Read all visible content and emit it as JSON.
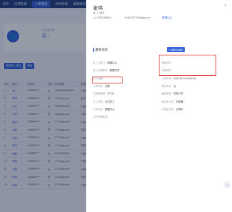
{
  "topnav": {
    "items": [
      "首页",
      "招聘管理",
      "人事管理",
      "绩效管理",
      "薪酬福利管理"
    ],
    "active_index": 2
  },
  "background": {
    "stats": [
      {
        "label": "待入职人数",
        "value": "0",
        "unit": "人"
      },
      {
        "label": "在职人数",
        "value": "20",
        "unit": "人"
      }
    ],
    "buttons": [
      "批量导入/导出",
      "筛选"
    ],
    "table_header": [
      "序号",
      "姓名",
      "手机号",
      "性别",
      "电子邮箱",
      "所属部门"
    ],
    "rows": [
      [
        "1",
        "张三",
        "1305690****",
        "女",
        "zhangsan@qq.com",
        "产品部"
      ],
      [
        "2",
        "李明",
        "1355690****",
        "男",
        "1234@qq.com",
        "设计部"
      ],
      [
        "3",
        "王芳",
        "1505690****",
        "女",
        "1234@qq.com",
        "产品部"
      ],
      [
        "4",
        "刘洋",
        "1505690****",
        "男",
        "1234@qq.com",
        "开发部"
      ],
      [
        "5",
        "陈静",
        "1585690****",
        "女",
        "2371@qq.com",
        "产品部"
      ],
      [
        "6",
        "赵磊",
        "1595690****",
        "男",
        "2371@qq.com",
        "开发部"
      ],
      [
        "7",
        "孙丽",
        "1325690****",
        "女",
        "2371@qq.com",
        "产品部"
      ],
      [
        "8",
        "周杰",
        "1335690****",
        "男",
        "2371@qq.com",
        "开发部"
      ],
      [
        "9",
        "吴敏",
        "1525690****",
        "女",
        "2371@qq.com",
        "产品部"
      ],
      [
        "10",
        "郑强",
        "1785690****",
        "男",
        "2371@qq.com",
        "产品部"
      ],
      [
        "11",
        "冯雪",
        "1795690****",
        "女",
        "2371@qq.com",
        "产品部"
      ],
      [
        "12",
        "林涛",
        "1805690****",
        "男",
        "2371@qq.com",
        "开发部"
      ],
      [
        "13",
        "何静",
        "1815690****",
        "女",
        "2371@qq.com",
        "产品部"
      ]
    ]
  },
  "drawer": {
    "name": "张伟",
    "meta": "男 丨 26岁",
    "phone": "13551508611",
    "email": "651307752@qq.com",
    "department_tag": "数据中心",
    "section_title": "基本信息",
    "edit_button": "编辑基本信息",
    "fields_left": [
      {
        "k": "员工归属门：",
        "v": "数据中心"
      },
      {
        "k": "员工归属职务：",
        "v": "数据专员"
      },
      {
        "k": "员工职级：",
        "v": ""
      },
      {
        "k": "入职状态：",
        "v": "试用"
      },
      {
        "k": "试用期期限：",
        "v": "3个月"
      },
      {
        "k": "员工类型：",
        "v": "正式员工"
      },
      {
        "k": "工作地点：",
        "v": "数据中心"
      },
      {
        "k": "合同签署类型：",
        "v": ""
      }
    ],
    "fields_right": [
      {
        "k": "直属领导：",
        "v": ""
      },
      {
        "k": "间接领导：",
        "v": ""
      },
      {
        "k": "入职时间：",
        "v": "2025-10-01 00:00:00"
      },
      {
        "k": "是否转正：",
        "v": "否"
      },
      {
        "k": "雇佣类型：",
        "v": "内部人员"
      },
      {
        "k": "是否签合同：",
        "v": "已签署"
      },
      {
        "k": "入职登记表：",
        "v": "已填写"
      }
    ],
    "close_icon": "close-icon",
    "help_icon": "help-icon"
  }
}
